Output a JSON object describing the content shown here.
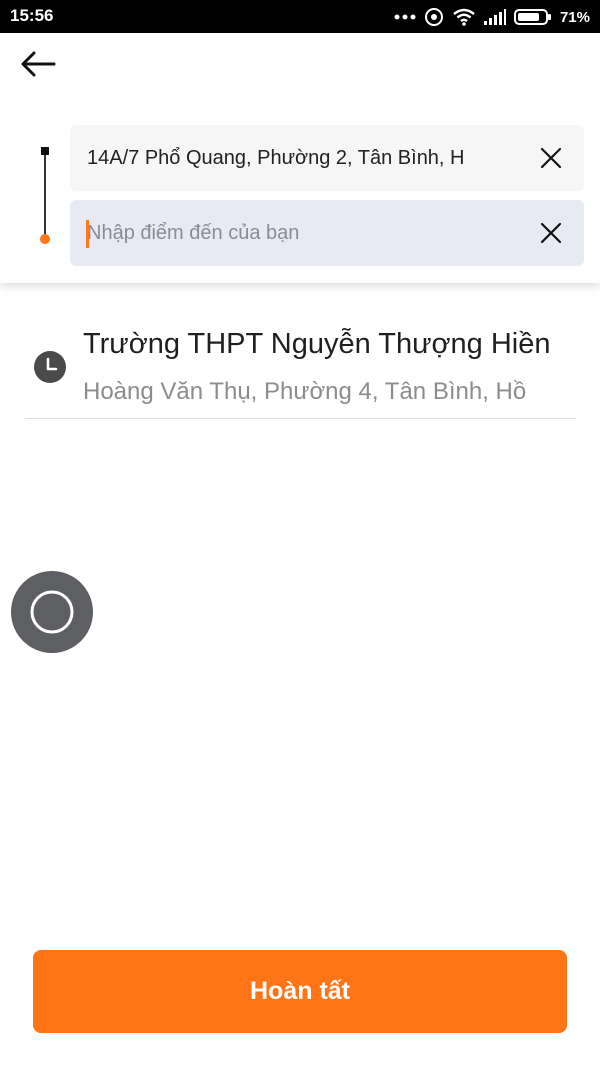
{
  "status_bar": {
    "time": "15:56",
    "battery_percent": "71%",
    "icons": [
      "more-dots-icon",
      "hotspot-icon",
      "wifi-icon",
      "signal-icon",
      "battery-icon"
    ]
  },
  "header": {
    "back_icon": "arrow-left-icon",
    "origin": {
      "value": "14A/7 Phổ Quang, Phường 2, Tân Bình, H",
      "clear_icon": "close-icon"
    },
    "destination": {
      "value": "",
      "placeholder": "Nhập điểm đến của bạn",
      "clear_icon": "close-icon"
    }
  },
  "history": [
    {
      "icon": "clock-icon",
      "title": "Trường THPT Nguyễn Thượng Hiền",
      "subtitle": "Hoàng Văn Thụ, Phường 4, Tân Bình, Hồ"
    }
  ],
  "floating_button": {
    "icon": "circle-icon"
  },
  "done_button": {
    "label": "Hoàn tất"
  },
  "colors": {
    "accent": "#ff7414",
    "status_bar": "#000000",
    "origin_field_bg": "#f6f6f6",
    "destination_field_bg": "#e8eaf3",
    "floating_button_bg": "#5d5f62"
  }
}
